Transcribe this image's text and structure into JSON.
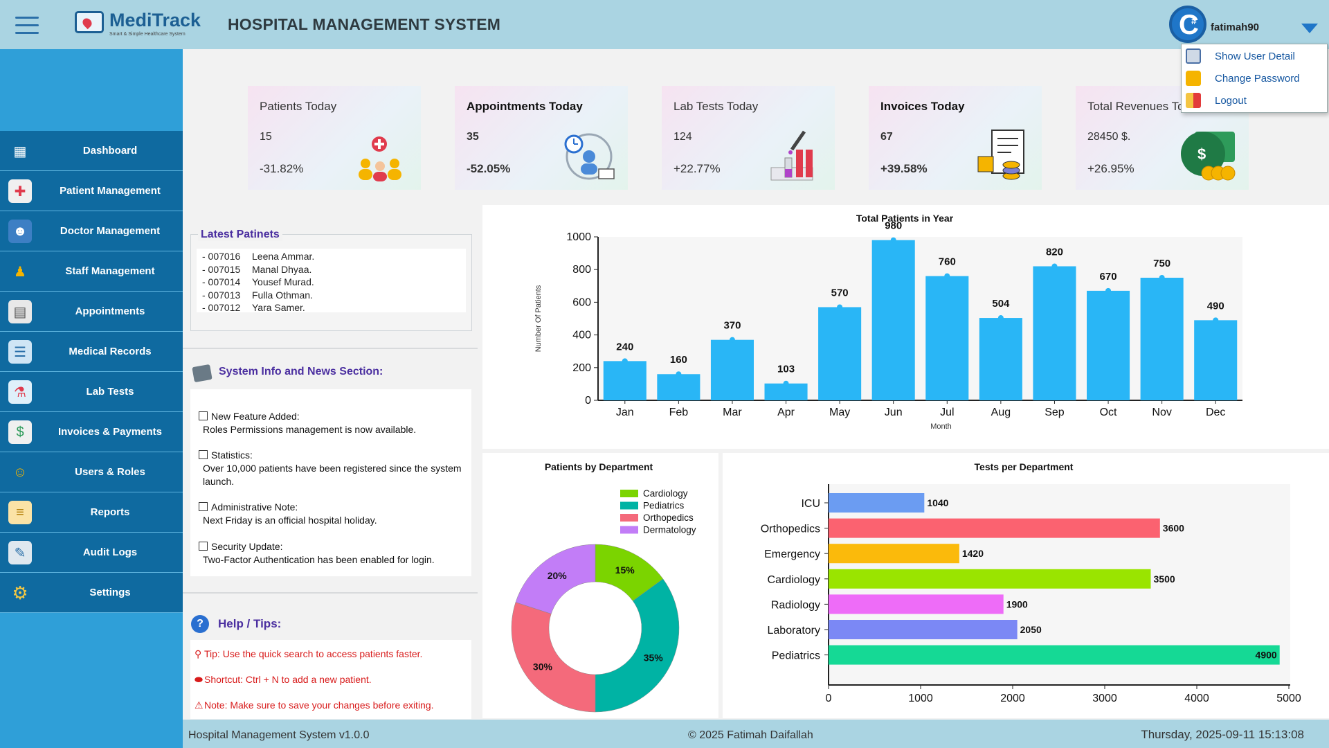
{
  "header": {
    "logo_name": "MediTrack",
    "logo_tagline": "Smart & Simple Healthcare System",
    "title": "HOSPITAL MANAGEMENT SYSTEM",
    "username": "fatimah90"
  },
  "user_menu": {
    "items": [
      {
        "label": "Show User Detail",
        "icon": "user-detail-icon"
      },
      {
        "label": "Change Password",
        "icon": "lock-icon"
      },
      {
        "label": "Logout",
        "icon": "logout-icon"
      }
    ]
  },
  "sidebar": {
    "items": [
      {
        "label": "Dashboard",
        "icon": "dashboard-icon"
      },
      {
        "label": "Patient Management",
        "icon": "patient-icon"
      },
      {
        "label": "Doctor Management",
        "icon": "doctor-icon"
      },
      {
        "label": "Staff Management",
        "icon": "staff-icon"
      },
      {
        "label": "Appointments",
        "icon": "calendar-icon"
      },
      {
        "label": "Medical Records",
        "icon": "records-icon"
      },
      {
        "label": "Lab Tests",
        "icon": "lab-icon"
      },
      {
        "label": "Invoices & Payments",
        "icon": "invoice-icon"
      },
      {
        "label": "Users & Roles",
        "icon": "users-icon"
      },
      {
        "label": "Reports",
        "icon": "reports-icon"
      },
      {
        "label": "Audit Logs",
        "icon": "audit-icon"
      },
      {
        "label": "Settings",
        "icon": "settings-icon"
      }
    ]
  },
  "cards": [
    {
      "title": "Patients Today",
      "value": "15",
      "change": "-31.82%",
      "icon": "patients-group-icon"
    },
    {
      "title": "Appointments Today",
      "value": "35",
      "change": "-52.05%",
      "icon": "appointment-clock-icon"
    },
    {
      "title": "Lab Tests Today",
      "value": "124",
      "change": "+22.77%",
      "icon": "test-tubes-icon"
    },
    {
      "title": "Invoices Today",
      "value": "67",
      "change": "+39.58%",
      "icon": "invoice-coins-icon"
    },
    {
      "title": "Total Revenues Today",
      "value": "28450 $.",
      "change": "+26.95%",
      "icon": "money-icon"
    }
  ],
  "latest_patients": {
    "title": "Latest Patinets",
    "rows": [
      {
        "id": "- 007016",
        "name": "Leena Ammar."
      },
      {
        "id": "- 007015",
        "name": "Manal Dhyaa."
      },
      {
        "id": "- 007014",
        "name": "Yousef Murad."
      },
      {
        "id": "- 007013",
        "name": "Fulla Othman."
      },
      {
        "id": "- 007012",
        "name": "Yara Samer."
      }
    ]
  },
  "info": {
    "title": "System Info and News Section:",
    "items": [
      {
        "head": "New Feature Added:",
        "body": "Roles  Permissions management is now available."
      },
      {
        "head": "Statistics:",
        "body": "Over 10,000 patients have been registered since the system launch."
      },
      {
        "head": "Administrative Note:",
        "body": "Next Friday is an official hospital holiday."
      },
      {
        "head": "Security Update:",
        "body": "Two-Factor Authentication has been enabled for login."
      }
    ]
  },
  "help": {
    "title": "Help / Tips:",
    "tips": [
      {
        "glyph": "⚲",
        "text": "Tip: Use the quick search to access patients faster."
      },
      {
        "glyph": "⬬",
        "text": "Shortcut: Ctrl + N to add a new patient."
      },
      {
        "glyph": "⚠",
        "text": "Note: Make sure to save your changes before exiting."
      }
    ]
  },
  "footer": {
    "version": "Hospital Management System v1.0.0",
    "copyright": "© 2025 Fatimah Daifallah",
    "datetime": "Thursday, 2025-09-11 15:13:08"
  },
  "chart_data": [
    {
      "type": "bar",
      "title": "Total Patients in Year",
      "xlabel": "Month",
      "ylabel": "Number Of Patients",
      "categories": [
        "Jan",
        "Feb",
        "Mar",
        "Apr",
        "May",
        "Jun",
        "Jul",
        "Aug",
        "Sep",
        "Oct",
        "Nov",
        "Dec"
      ],
      "values": [
        240,
        160,
        370,
        103,
        570,
        980,
        760,
        504,
        820,
        670,
        750,
        490
      ],
      "ylim": [
        0,
        1000
      ],
      "yticks": [
        0,
        200,
        400,
        600,
        800,
        1000
      ],
      "color": "#29b6f6"
    },
    {
      "type": "pie",
      "title": "Patients by Department",
      "legend_position": "top-right",
      "slices": [
        {
          "label": "Cardiology",
          "value": 15,
          "color": "#7bd400"
        },
        {
          "label": "Pediatrics",
          "value": 35,
          "color": "#00b3a4"
        },
        {
          "label": "Orthopedics",
          "value": 30,
          "color": "#f46a7b"
        },
        {
          "label": "Dermatology",
          "value": 20,
          "color": "#c27df7"
        }
      ]
    },
    {
      "type": "bar",
      "orientation": "horizontal",
      "title": "Tests per Department",
      "categories": [
        "ICU",
        "Orthopedics",
        "Emergency",
        "Cardiology",
        "Radiology",
        "Laboratory",
        "Pediatrics"
      ],
      "values": [
        1040,
        3600,
        1420,
        3500,
        1900,
        2050,
        4900
      ],
      "colors": [
        "#6b9cf2",
        "#fb6270",
        "#fbba0b",
        "#9ae400",
        "#ee6cf8",
        "#7b88f5",
        "#15d995"
      ],
      "xlim": [
        0,
        5000
      ],
      "xticks": [
        0,
        1000,
        2000,
        3000,
        4000,
        5000
      ]
    }
  ]
}
